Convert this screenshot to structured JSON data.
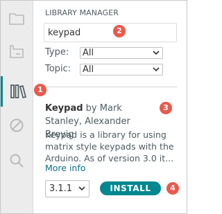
{
  "activity_bar": {
    "items": [
      {
        "icon": "folder-icon"
      },
      {
        "icon": "board-manager-icon"
      },
      {
        "icon": "library-manager-icon",
        "active": true
      },
      {
        "icon": "debug-icon"
      },
      {
        "icon": "search-icon"
      }
    ]
  },
  "library_manager": {
    "title": "LIBRARY MANAGER",
    "search_value": "keypad",
    "type_label": "Type:",
    "type_value": "All",
    "topic_label": "Topic:",
    "topic_value": "All"
  },
  "library": {
    "name": "Keypad",
    "author_prefix": "by",
    "authors": "Mark Stanley, Alexander Brevig",
    "description": "Keypad is a library for using matrix style keypads with the Arduino. As of version 3.0 it...",
    "more_info": "More info",
    "version": "3.1.1",
    "install_label": "INSTALL"
  },
  "badges": {
    "b1": "1",
    "b2": "2",
    "b3": "3",
    "b4": "4"
  },
  "colors": {
    "accent": "#00878f",
    "badge": "#e9594c",
    "link": "#0b6e89",
    "activity_bg": "#ececec"
  }
}
